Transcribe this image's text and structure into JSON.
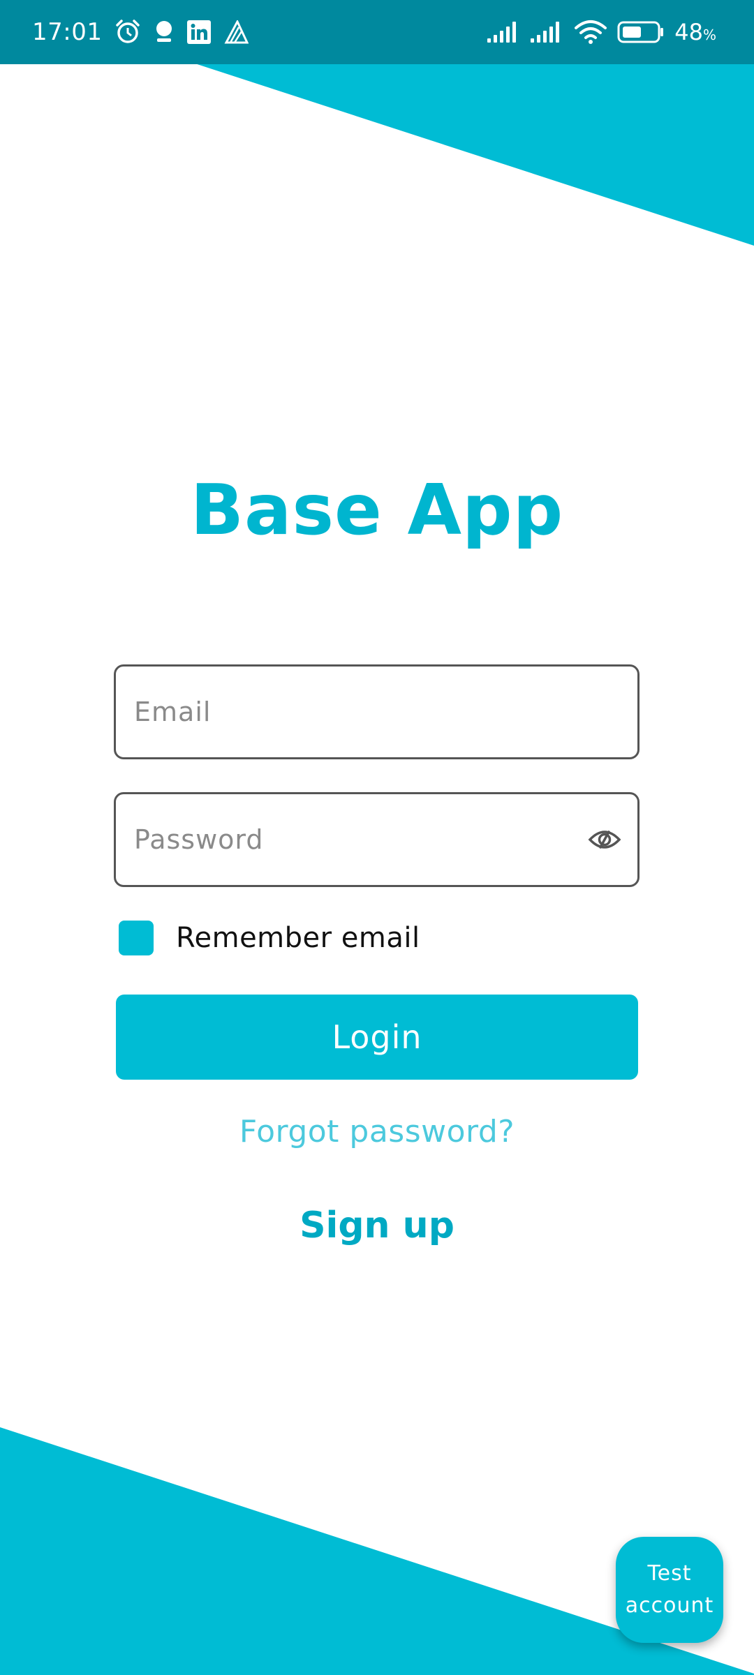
{
  "status_bar": {
    "time": "17:01",
    "battery_percent": "48",
    "battery_unit": "%",
    "icons": [
      "alarm-icon",
      "notification-icon",
      "linkedin-icon",
      "app-icon",
      "signal-icon",
      "signal-icon",
      "wifi-icon",
      "battery-icon"
    ]
  },
  "app": {
    "title": "Base App"
  },
  "login_form": {
    "email_placeholder": "Email",
    "password_placeholder": "Password",
    "remember_label": "Remember email",
    "remember_checked": true,
    "login_label": "Login",
    "forgot_label": "Forgot password?",
    "signup_label": "Sign up"
  },
  "fab": {
    "line1": "Test",
    "line2": "account"
  },
  "colors": {
    "accent": "#00bcd4",
    "status_bar": "#00899e",
    "title": "#00b5cf",
    "link": "#4cc9dd"
  }
}
